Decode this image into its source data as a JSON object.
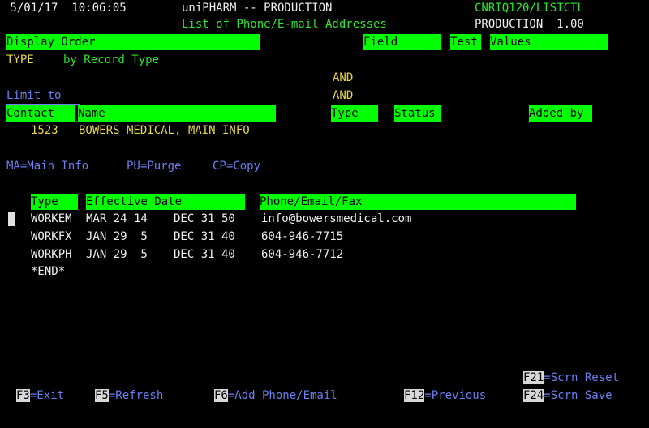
{
  "header": {
    "datetime": " 5/01/17  10:06:05",
    "app_title": "uniPHARM -- PRODUCTION",
    "screen_id": "CNRIQ120/LISTCTL",
    "screen_title": "List of Phone/E-mail Addresses",
    "env_label": "PRODUCTION  1.00"
  },
  "filter_headers": {
    "display_order": "Display Order",
    "field": "Field",
    "test": "Test",
    "values": "Values"
  },
  "type_row": {
    "label": "TYPE",
    "value": "by Record Type"
  },
  "and_1": "AND",
  "limit_to": "Limit to",
  "and_2": "AND",
  "contact_headers": {
    "contact": "Contact",
    "name": "Name",
    "type": "Type",
    "status": "Status",
    "added_by": "Added by"
  },
  "contact": {
    "number": "1523",
    "name": "BOWERS MEDICAL, MAIN INFO"
  },
  "options": {
    "ma": "MA=Main Info",
    "pu": "PU=Purge",
    "cp": "CP=Copy"
  },
  "list_headers": {
    "type": "Type",
    "effective_date": "Effective Date",
    "phone_email_fax": "Phone/Email/Fax"
  },
  "rows": [
    {
      "type": "WORKEM",
      "eff_from": "MAR 24 14",
      "eff_to": "DEC 31 50",
      "value": "info@bowersmedical.com"
    },
    {
      "type": "WORKFX",
      "eff_from": "JAN 29  5",
      "eff_to": "DEC 31 40",
      "value": "604-946-7715"
    },
    {
      "type": "WORKPH",
      "eff_from": "JAN 29  5",
      "eff_to": "DEC 31 40",
      "value": "604-946-7712"
    }
  ],
  "end_marker": "*END*",
  "fkeys": {
    "f21_key": "F21",
    "f21_label": "=Scrn Reset",
    "f3_key": "F3",
    "f3_label": "=Exit",
    "f5_key": "F5",
    "f5_label": "=Refresh",
    "f6_key": "F6",
    "f6_label": "=Add Phone/Email",
    "f12_key": "F12",
    "f12_label": "=Previous",
    "f24_key": "F24",
    "f24_label": "=Scrn Save"
  }
}
